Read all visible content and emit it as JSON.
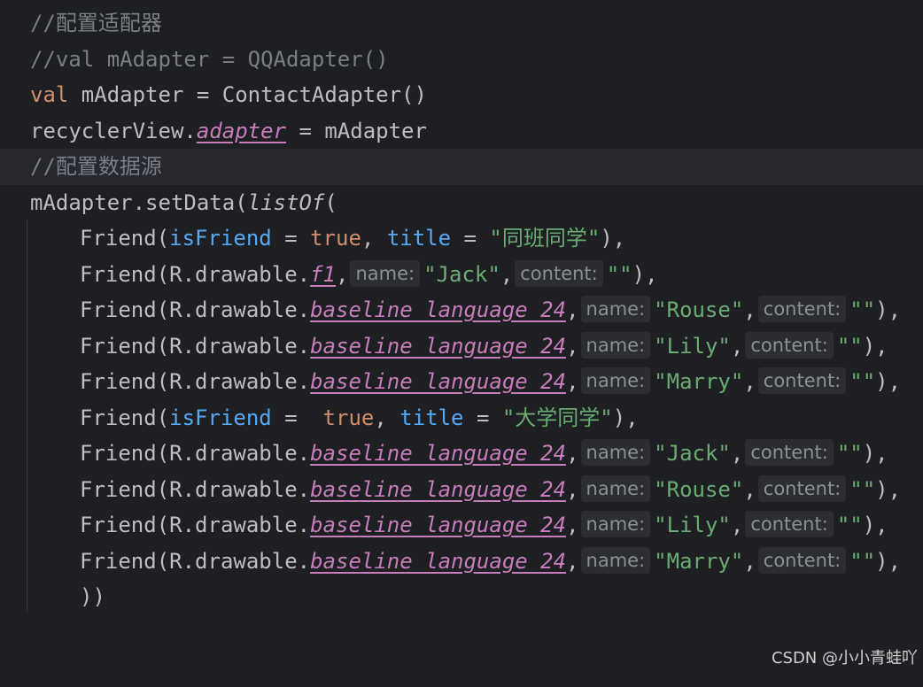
{
  "editor": {
    "lines": [
      {
        "comment": "//配置适配器"
      },
      {
        "comment": "//val mAdapter = QQAdapter()"
      },
      {
        "kw": "val",
        "rest": " mAdapter = ContactAdapter()"
      },
      {
        "recv": "recyclerView.",
        "prop": "adapter",
        "rest": " = mAdapter"
      },
      {
        "comment": "//配置数据源"
      },
      {
        "pre": "mAdapter.setData(",
        "fn": "listOf",
        "post": "("
      }
    ],
    "friends": [
      {
        "type": "group",
        "ctor": "Friend(",
        "named1": "isFriend",
        "eq1": " = ",
        "bool": "true",
        "sep": ", ",
        "named2": "title",
        "eq2": " = ",
        "str": "\"同班同学\"",
        "close": "),"
      },
      {
        "type": "item",
        "ctor": "Friend(R.drawable.",
        "res": "f1",
        "comma": ",",
        "hint1": "name:",
        "name": "\"Jack\"",
        "comma2": ",",
        "hint2": "content:",
        "content": "\"\"",
        "close": "),"
      },
      {
        "type": "item",
        "ctor": "Friend(R.drawable.",
        "res": "baseline_language_24",
        "comma": ",",
        "hint1": "name:",
        "name": "\"Rouse\"",
        "comma2": ",",
        "hint2": "content:",
        "content": "\"\"",
        "close": "),"
      },
      {
        "type": "item",
        "ctor": "Friend(R.drawable.",
        "res": "baseline_language_24",
        "comma": ",",
        "hint1": "name:",
        "name": "\"Lily\"",
        "comma2": ",",
        "hint2": "content:",
        "content": "\"\"",
        "close": "),"
      },
      {
        "type": "item",
        "ctor": "Friend(R.drawable.",
        "res": "baseline_language_24",
        "comma": ",",
        "hint1": "name:",
        "name": "\"Marry\"",
        "comma2": ",",
        "hint2": "content:",
        "content": "\"\"",
        "close": "),"
      },
      {
        "type": "group",
        "ctor": "Friend(",
        "named1": "isFriend",
        "eq1": " =  ",
        "bool": "true",
        "sep": ", ",
        "named2": "title",
        "eq2": " = ",
        "str": "\"大学同学\"",
        "close": "),"
      },
      {
        "type": "item",
        "ctor": "Friend(R.drawable.",
        "res": "baseline_language_24",
        "comma": ",",
        "hint1": "name:",
        "name": "\"Jack\"",
        "comma2": ",",
        "hint2": "content:",
        "content": "\"\"",
        "close": "),"
      },
      {
        "type": "item",
        "ctor": "Friend(R.drawable.",
        "res": "baseline_language_24",
        "comma": ",",
        "hint1": "name:",
        "name": "\"Rouse\"",
        "comma2": ",",
        "hint2": "content:",
        "content": "\"\"",
        "close": "),"
      },
      {
        "type": "item",
        "ctor": "Friend(R.drawable.",
        "res": "baseline_language_24",
        "comma": ",",
        "hint1": "name:",
        "name": "\"Lily\"",
        "comma2": ",",
        "hint2": "content:",
        "content": "\"\"",
        "close": "),"
      },
      {
        "type": "item",
        "ctor": "Friend(R.drawable.",
        "res": "baseline_language_24",
        "comma": ",",
        "hint1": "name:",
        "name": "\"Marry\"",
        "comma2": ",",
        "hint2": "content:",
        "content": "\"\"",
        "close": "),"
      }
    ],
    "closing": "))"
  },
  "watermark": "CSDN @小小青蛙吖"
}
